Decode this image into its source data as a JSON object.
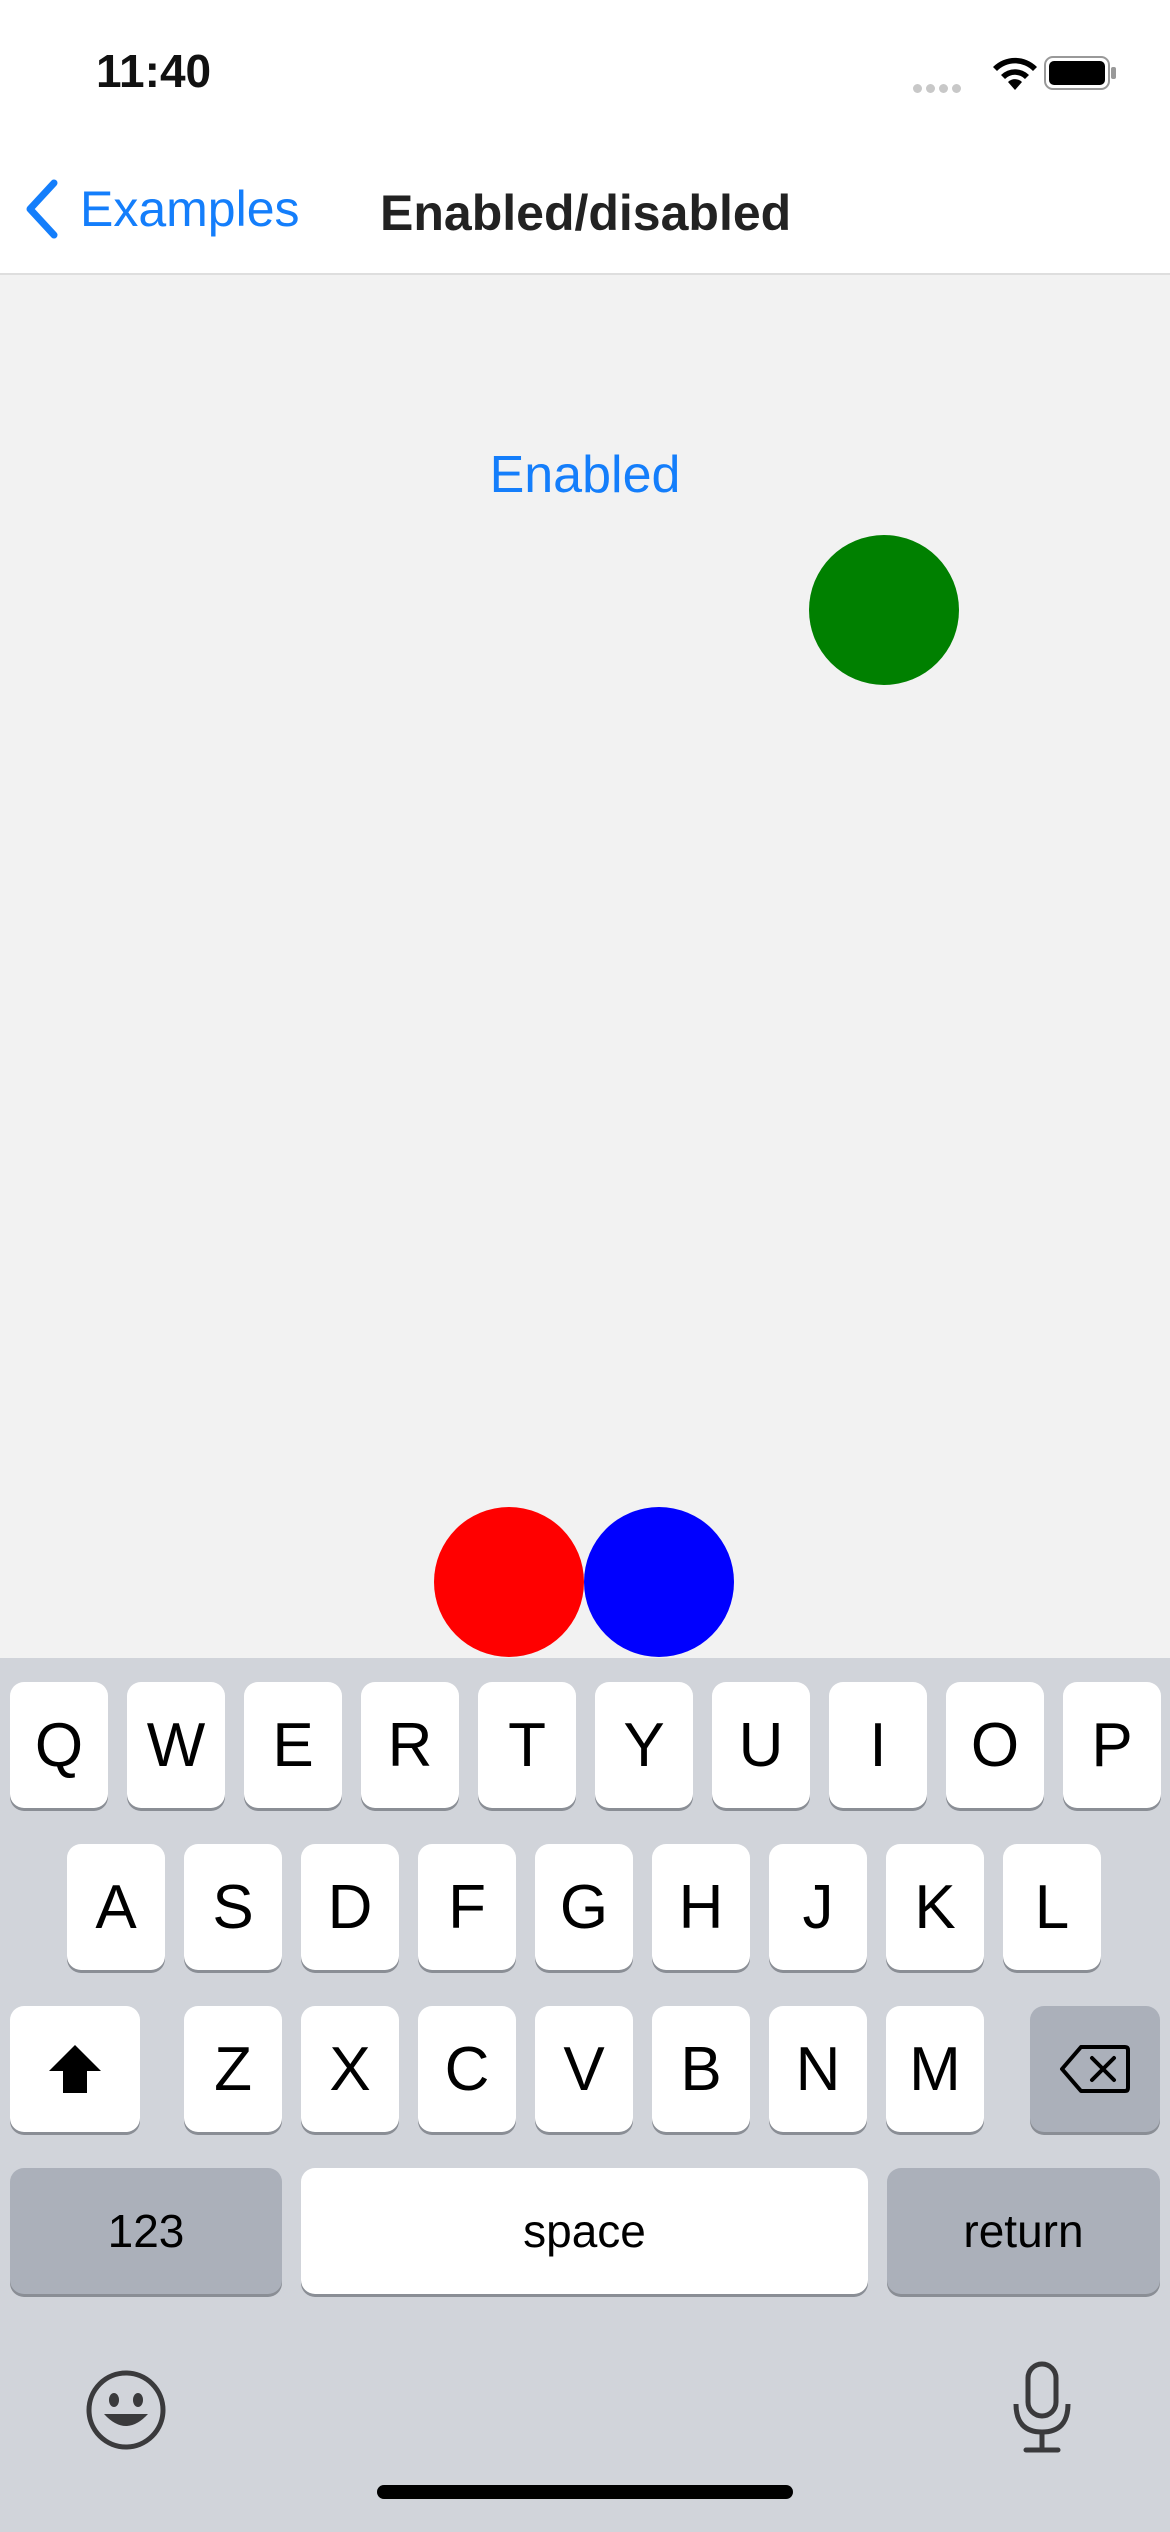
{
  "status_bar": {
    "time": "11:40"
  },
  "nav": {
    "back_label": "Examples",
    "title": "Enabled/disabled"
  },
  "content": {
    "toggle_label": "Enabled"
  },
  "keyboard": {
    "row1": [
      "Q",
      "W",
      "E",
      "R",
      "T",
      "Y",
      "U",
      "I",
      "O",
      "P"
    ],
    "row2": [
      "A",
      "S",
      "D",
      "F",
      "G",
      "H",
      "J",
      "K",
      "L"
    ],
    "row3": [
      "Z",
      "X",
      "C",
      "V",
      "B",
      "N",
      "M"
    ],
    "numbers_label": "123",
    "space_label": "space",
    "return_label": "return"
  },
  "colors": {
    "accent": "#147efb",
    "green_circle": "#008000",
    "red_circle": "#ff0000",
    "blue_circle": "#0000ff"
  },
  "icons": [
    "signal-icon",
    "wifi-icon",
    "battery-icon",
    "chevron-left-icon",
    "shift-icon",
    "delete-icon",
    "emoji-icon",
    "microphone-icon"
  ]
}
